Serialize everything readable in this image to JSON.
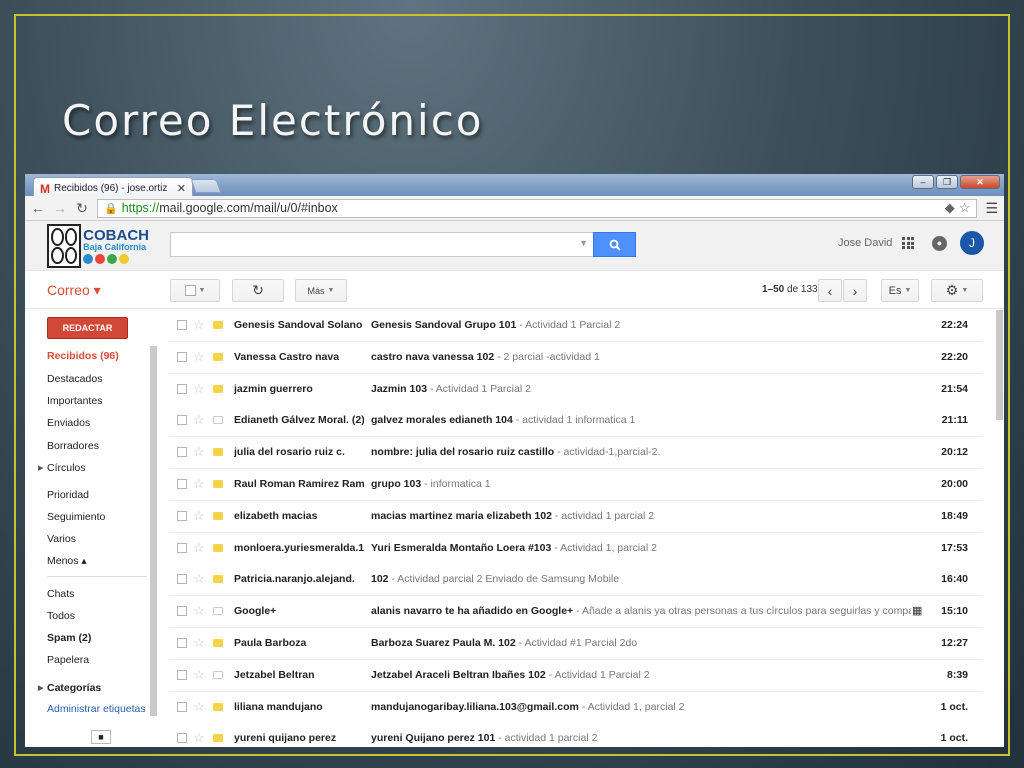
{
  "slide": {
    "title": "Correo Electrónico"
  },
  "browser": {
    "tab_title": "Recibidos (96) - jose.ortiz",
    "tab_close": "✕",
    "url_https": "https://",
    "url_rest": "mail.google.com/mail/u/0/#inbox",
    "window_buttons": [
      "–",
      "❐",
      "✕"
    ]
  },
  "header": {
    "logo_name": "COBACH",
    "logo_sub": "Baja California",
    "logo_dots": [
      "#2a8bcc",
      "#e8463a",
      "#3aa84a",
      "#f0c830"
    ],
    "user_name": "Jose David",
    "avatar_letter": "J"
  },
  "toolbar": {
    "correo_label": "Correo ▾",
    "mas_label": "Más",
    "range_bold": "1–50",
    "range_rest": " de 133",
    "lang_label": "Es",
    "colors": {
      "accent": "#dd4b39",
      "compose": "#d14836",
      "search": "#4d90fe"
    }
  },
  "sidebar": {
    "compose_label": "REDACTAR",
    "items": [
      {
        "label": "Recibidos (96)",
        "style": "active"
      },
      {
        "label": "Destacados",
        "style": ""
      },
      {
        "label": "Importantes",
        "style": ""
      },
      {
        "label": "Enviados",
        "style": ""
      },
      {
        "label": "Borradores",
        "style": ""
      },
      {
        "label": "Círculos",
        "style": "arrow"
      },
      {
        "label": "Prioridad",
        "style": ""
      },
      {
        "label": "Seguimiento",
        "style": ""
      },
      {
        "label": "Varios",
        "style": ""
      },
      {
        "label": "Menos ▴",
        "style": ""
      },
      {
        "label": "Chats",
        "style": ""
      },
      {
        "label": "Todos",
        "style": ""
      },
      {
        "label": "Spam (2)",
        "style": "bold"
      },
      {
        "label": "Papelera",
        "style": ""
      },
      {
        "label": "Categorías",
        "style": "bold-arrow"
      },
      {
        "label": "Administrar etiquetas",
        "style": "link"
      }
    ]
  },
  "emails": [
    {
      "sender": "Genesis Sandoval Solano",
      "subject": "Genesis Sandoval Grupo 101",
      "snippet": " - Actividad 1 Parcial 2",
      "time": "22:24",
      "label": "yellow"
    },
    {
      "sender": "Vanessa Castro nava",
      "subject": "castro nava vanessa 102",
      "snippet": " - 2 parcial -actividad 1",
      "time": "22:20",
      "label": "yellow"
    },
    {
      "sender": "jazmin guerrero",
      "subject": "Jazmin 103",
      "snippet": " - Actividad 1 Parcial 2",
      "time": "21:54",
      "label": "yellow"
    },
    {
      "sender": "Edianeth Gálvez Moral. (2)",
      "subject": "galvez morales edianeth 104",
      "snippet": " - actividad 1 informatica 1",
      "time": "21:11",
      "label": "empty"
    },
    {
      "sender": "julia del rosario ruiz c.",
      "subject": "nombre: julia del rosario ruiz castillo",
      "snippet": " - actividad-1,parcial-2.",
      "time": "20:12",
      "label": "yellow"
    },
    {
      "sender": "Raul Roman Ramirez Ramir.",
      "subject": "grupo 103",
      "snippet": " - informatica 1",
      "time": "20:00",
      "label": "yellow"
    },
    {
      "sender": "elizabeth macias",
      "subject": "macias martinez maria elizabeth 102",
      "snippet": " - actividad 1 parcial 2",
      "time": "18:49",
      "label": "yellow"
    },
    {
      "sender": "monloera.yuriesmeralda.1.",
      "subject": "Yuri Esmeralda Montaño Loera #103",
      "snippet": " - Actividad 1, parcial 2",
      "time": "17:53",
      "label": "yellow"
    },
    {
      "sender": "Patricia.naranjo.alejand.",
      "subject": "102",
      "snippet": " - Actividad parcial 2 Enviado de Samsung Mobile",
      "time": "16:40",
      "label": "yellow"
    },
    {
      "sender": "Google+",
      "subject": "alanis navarro te ha añadido en Google+",
      "snippet": " - Añade a alanis ya otras personas a tus círculos para seguirlas y compartir con ellas",
      "time": "15:10",
      "label": "empty",
      "extra": "▦"
    },
    {
      "sender": "Paula Barboza",
      "subject": "Barboza Suarez Paula M. 102",
      "snippet": " - Actividad #1 Parcial 2do",
      "time": "12:27",
      "label": "yellow"
    },
    {
      "sender": "Jetzabel Beltran",
      "subject": "Jetzabel Araceli Beltran Ibañes 102",
      "snippet": " - Actividad 1 Parcial 2",
      "time": "8:39",
      "label": "empty"
    },
    {
      "sender": "liliana mandujano",
      "subject": "mandujanogaribay.liliana.103@gmail.com",
      "snippet": " - Actividad 1, parcial 2",
      "time": "1 oct.",
      "label": "yellow"
    },
    {
      "sender": "yureni quijano perez",
      "subject": "yureni Quijano perez 101",
      "snippet": " - actividad 1 parcial 2",
      "time": "1 oct.",
      "label": "yellow"
    }
  ]
}
